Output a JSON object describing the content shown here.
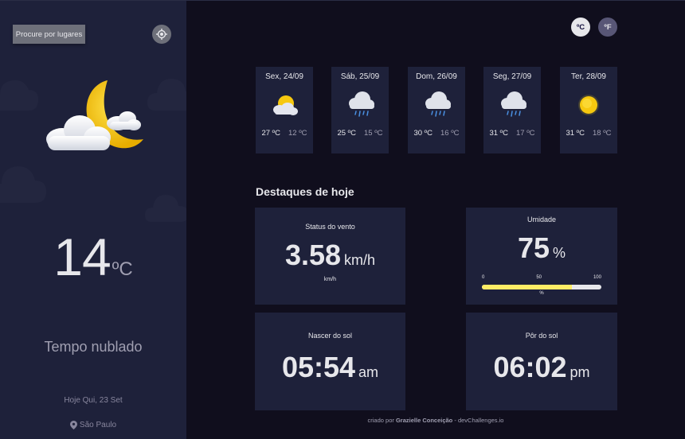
{
  "sidebar": {
    "search_label": "Procure por lugares",
    "locate_icon": "crosshair-icon",
    "weather_icon": "moon-cloud-icon",
    "temperature": "14",
    "temperature_unit": "ºC",
    "condition": "Tempo nublado",
    "date": "Hoje Qui, 23 Set",
    "location": "São Paulo",
    "location_icon": "map-pin-icon"
  },
  "units": {
    "celsius": "ºC",
    "fahrenheit": "ºF",
    "active": "celsius"
  },
  "forecast": [
    {
      "day": "Sex, 24/09",
      "icon": "sun-cloud-icon",
      "max": "27 ºC",
      "min": "12 ºC"
    },
    {
      "day": "Sáb, 25/09",
      "icon": "rain-cloud-icon",
      "max": "25 ºC",
      "min": "15 ºC"
    },
    {
      "day": "Dom, 26/09",
      "icon": "rain-cloud-icon",
      "max": "30 ºC",
      "min": "16 ºC"
    },
    {
      "day": "Seg, 27/09",
      "icon": "rain-cloud-icon",
      "max": "31 ºC",
      "min": "17 ºC"
    },
    {
      "day": "Ter, 28/09",
      "icon": "sun-icon",
      "max": "31 ºC",
      "min": "18 ºC"
    }
  ],
  "highlights": {
    "title": "Destaques de hoje",
    "wind": {
      "label": "Status do vento",
      "value": "3.58",
      "unit": "km/h",
      "sub": "km/h"
    },
    "humidity": {
      "label": "Umidade",
      "value": "75",
      "unit": "%",
      "scale": [
        "0",
        "50",
        "100"
      ],
      "percent_label": "%",
      "fraction": 0.75
    },
    "sunrise": {
      "label": "Nascer do sol",
      "value": "05:54",
      "unit": "am"
    },
    "sunset": {
      "label": "Pôr do sol",
      "value": "06:02",
      "unit": "pm"
    }
  },
  "footer": {
    "prefix": "criado por",
    "author": "Grazielle Conceição",
    "separator": "-",
    "site": "devChallenges.io"
  },
  "colors": {
    "page_bg": "#100e1d",
    "card_bg": "#1e213a",
    "text": "#e7e7eb",
    "muted": "#a09fb1",
    "bar_fill": "#ffec65",
    "moon": "#f6c80f"
  }
}
